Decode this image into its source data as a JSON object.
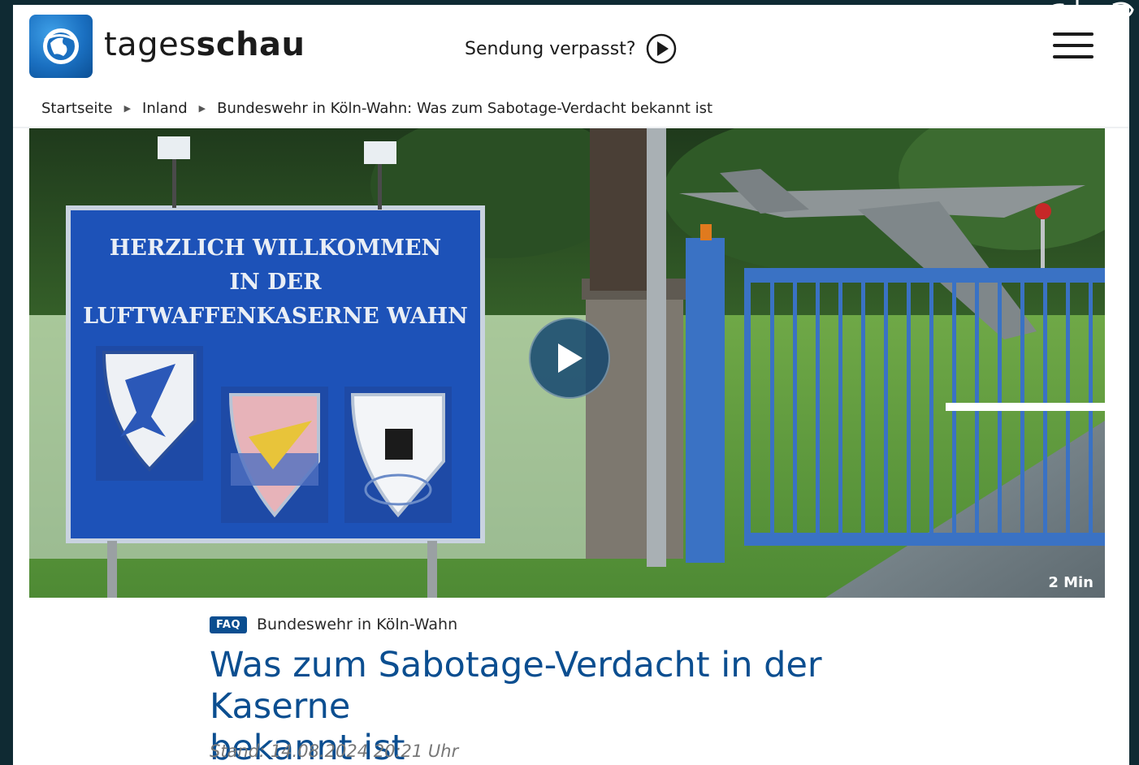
{
  "header": {
    "logo_prefix": "tages",
    "logo_suffix": "schau",
    "missed_label": "Sendung verpasst?"
  },
  "breadcrumb": {
    "items": [
      "Startseite",
      "Inland",
      "Bundeswehr in Köln-Wahn: Was zum Sabotage-Verdacht bekannt ist"
    ]
  },
  "hero": {
    "duration": "2 Min",
    "sign_line1": "HERZLICH WILLKOMMEN",
    "sign_line2": "IN DER",
    "sign_line3": "LUFTWAFFENKASERNE WAHN"
  },
  "article": {
    "badge": "FAQ",
    "topic": "Bundeswehr in Köln-Wahn",
    "headline_line1": "Was zum Sabotage-Verdacht in der Kaserne",
    "headline_line2": "bekannt ist",
    "stand": "Stand: 14.08.2024 20:21 Uhr"
  },
  "colors": {
    "brand_blue": "#0b4e90",
    "background_dark": "#0f2a33"
  }
}
